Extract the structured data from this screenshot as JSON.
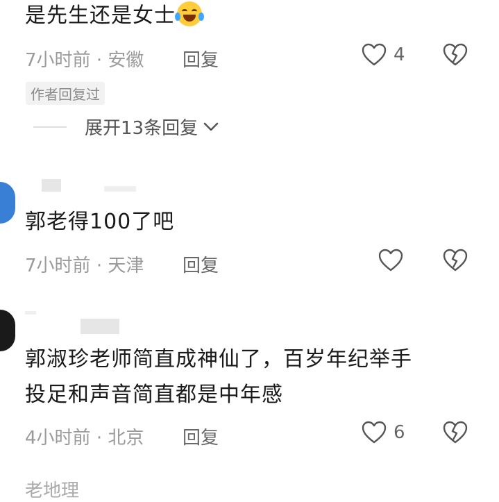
{
  "comments": [
    {
      "text": "是先生还是女士",
      "emoji": "laughing-tears-emoji",
      "time": "7小时前",
      "location": "安徽",
      "reply_label": "回复",
      "likes": "4",
      "badge": "作者回复过",
      "expand_label": "展开13条回复"
    },
    {
      "text": "郭老得100了吧",
      "time": "7小时前",
      "location": "天津",
      "reply_label": "回复",
      "likes": ""
    },
    {
      "text_line1": "郭淑珍老师简直成神仙了，百岁年纪举手",
      "text_line2": "投足和声音简直都是中年感",
      "time": "4小时前",
      "location": "北京",
      "reply_label": "回复",
      "likes": "6"
    }
  ],
  "next_username_partial": "老地理",
  "separator": "·",
  "icons": {
    "like": "heart-outline-icon",
    "dislike": "broken-heart-icon",
    "expand": "chevron-down-icon"
  },
  "colors": {
    "text": "#1a1a1a",
    "meta": "#9a9a9a",
    "icon": "#555555",
    "avatar_blue": "#3a7fd6"
  }
}
